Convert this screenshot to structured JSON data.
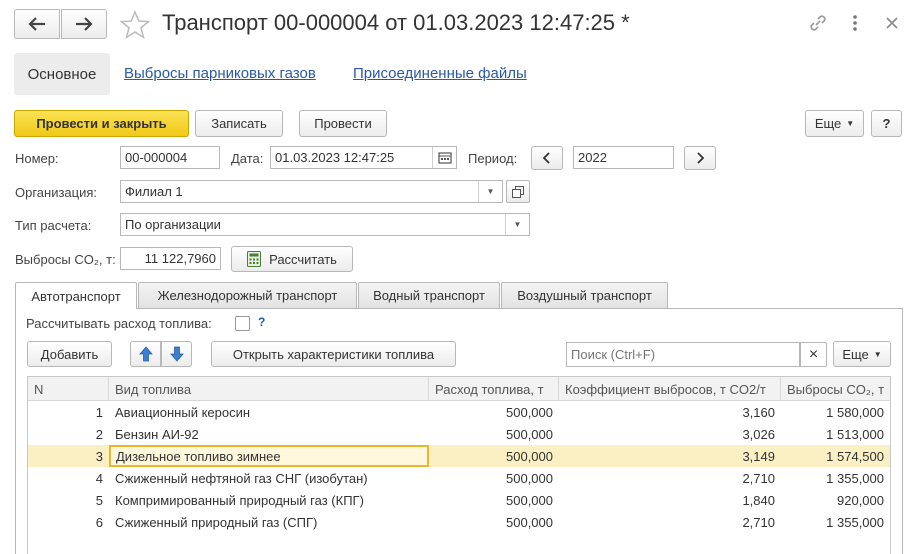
{
  "window": {
    "title": "Транспорт 00-000004 от 01.03.2023 12:47:25 *"
  },
  "nav": {
    "main": "Основное",
    "emissions_link": "Выбросы парниковых газов",
    "files_link": "Присоединенные файлы"
  },
  "toolbar": {
    "post_close": "Провести и закрыть",
    "save": "Записать",
    "post": "Провести",
    "more": "Еще",
    "help": "?"
  },
  "form": {
    "number_label": "Номер:",
    "number_value": "00-000004",
    "date_label": "Дата:",
    "date_value": "01.03.2023 12:47:25",
    "period_label": "Период:",
    "period_value": "2022",
    "org_label": "Организация:",
    "org_value": "Филиал 1",
    "calc_type_label": "Тип расчета:",
    "calc_type_value": "По организации",
    "co2_label": "Выбросы CO₂, т:",
    "co2_value": "11 122,7960",
    "calc_button": "Рассчитать"
  },
  "tabs": [
    {
      "label": "Автотранспорт"
    },
    {
      "label": "Железнодорожный транспорт"
    },
    {
      "label": "Водный транспорт"
    },
    {
      "label": "Воздушный транспорт"
    }
  ],
  "panel": {
    "fuel_calc_label": "Рассчитывать расход топлива:",
    "fuel_calc_help": "?",
    "add_button": "Добавить",
    "open_fuel_button": "Открыть характеристики топлива",
    "search_placeholder": "Поиск (Ctrl+F)",
    "clear": "×",
    "more": "Еще"
  },
  "table": {
    "headers": [
      "N",
      "Вид топлива",
      "Расход топлива, т",
      "Коэффициент выбросов, т CO2/т",
      "Выбросы CO₂, т"
    ],
    "rows": [
      {
        "n": "1",
        "fuel": "Авиационный керосин",
        "consumption": "500,000",
        "coef": "3,160",
        "emissions": "1 580,000"
      },
      {
        "n": "2",
        "fuel": "Бензин АИ-92",
        "consumption": "500,000",
        "coef": "3,026",
        "emissions": "1 513,000"
      },
      {
        "n": "3",
        "fuel": "Дизельное топливо зимнее",
        "consumption": "500,000",
        "coef": "3,149",
        "emissions": "1 574,500"
      },
      {
        "n": "4",
        "fuel": "Сжиженный нефтяной газ СНГ (изобутан)",
        "consumption": "500,000",
        "coef": "2,710",
        "emissions": "1 355,000"
      },
      {
        "n": "5",
        "fuel": "Компримированный природный газ (КПГ)",
        "consumption": "500,000",
        "coef": "1,840",
        "emissions": "920,000"
      },
      {
        "n": "6",
        "fuel": "Сжиженный природный газ (СПГ)",
        "consumption": "500,000",
        "coef": "2,710",
        "emissions": "1 355,000"
      }
    ]
  },
  "colors": {
    "accent_yellow": "#f5d21f",
    "selected_row": "#fbf0c4",
    "link": "#2a58ad",
    "arrow_blue": "#3a7fd0"
  }
}
